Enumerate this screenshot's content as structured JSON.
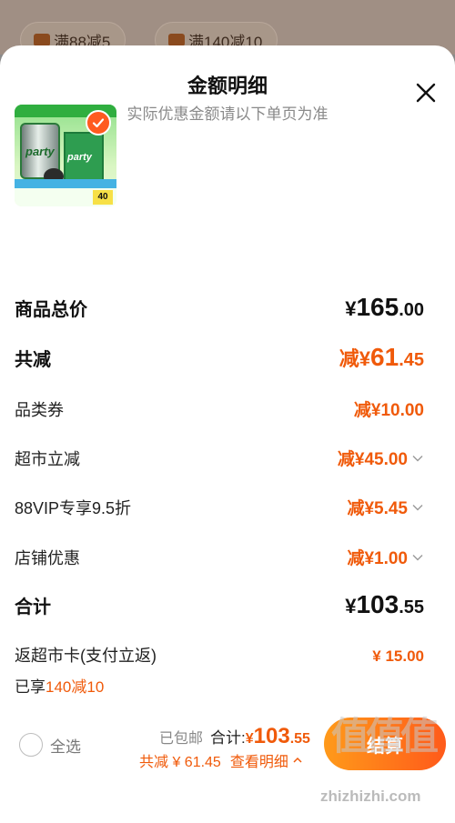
{
  "background": {
    "coupon_chips": [
      {
        "label": "满88减5"
      },
      {
        "label": "满140减10"
      }
    ]
  },
  "sheet": {
    "title": "金额明细",
    "subtitle": "实际优惠金额请以下单页为准"
  },
  "product": {
    "image_alt": "party beer",
    "selected": true,
    "image_text": {
      "can_label": "party",
      "box_label": "party",
      "price": "40"
    }
  },
  "rows": {
    "total_price": {
      "label": "商品总价",
      "yen": "¥",
      "int": "165",
      "dec": ".00"
    },
    "total_discount": {
      "label": "共减",
      "prefix": "减¥",
      "int": "61",
      "dec": ".45"
    },
    "category_coupon": {
      "label": "品类券",
      "value": "减¥10.00"
    },
    "supermarket_discount": {
      "label": "超市立减",
      "value": "减¥45.00"
    },
    "vip_discount": {
      "label": "88VIP专享9.5折",
      "value": "减¥5.45"
    },
    "store_discount": {
      "label": "店铺优惠",
      "value": "减¥1.00"
    },
    "subtotal": {
      "label": "合计",
      "yen": "¥",
      "int": "103",
      "dec": ".55"
    },
    "rebate": {
      "label": "返超市卡(支付立返)",
      "value": "¥ 15.00"
    }
  },
  "enjoyed": {
    "prefix": "已享",
    "highlight": "140减10"
  },
  "footer": {
    "select_all": "全选",
    "shipping": "已包邮",
    "total_label": "合计:",
    "total_yen": "¥",
    "total_int": "103",
    "total_dec": ".55",
    "saved": "共减 ¥ 61.45",
    "details_label": "查看明细",
    "checkout_label": "结算"
  },
  "watermark": {
    "glyphs": "值值值",
    "url": "zhizhizhi.com"
  },
  "colors": {
    "accent": "#f05a0a",
    "checkout_start": "#ff9a1a",
    "checkout_end": "#ff5a1a"
  }
}
